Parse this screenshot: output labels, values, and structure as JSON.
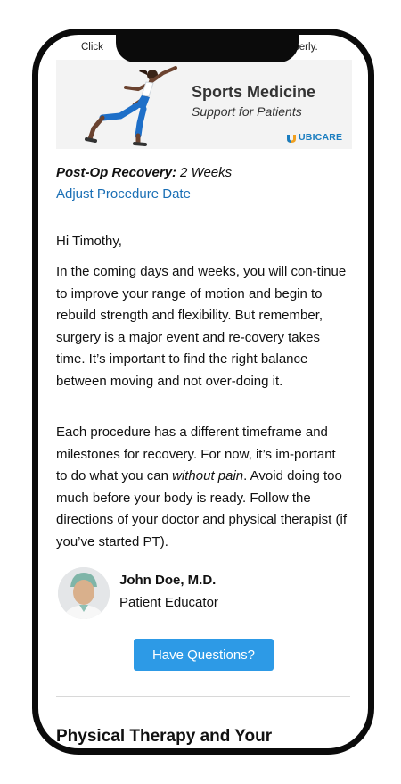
{
  "preheader": {
    "left": "Click",
    "right": "operly."
  },
  "hero": {
    "title": "Sports Medicine",
    "subtitle": "Support for Patients",
    "logo_text": "UBICARE",
    "accent_color": "#1a7dc0"
  },
  "recovery": {
    "label": "Post-Op Recovery:",
    "value": "2 Weeks"
  },
  "adjust_link": "Adjust Procedure Date",
  "greeting": "Hi Timothy,",
  "paragraph_1": "In the coming days and weeks, you will con-tinue to improve your range of motion and begin to rebuild strength and flexibility. But remember, surgery is a major event and re-covery takes time. It’s important to find the right balance between moving and not over-doing it.",
  "paragraph_2": {
    "before": "Each procedure has a different timeframe and milestones for recovery. For now, it’s im-portant to do what you can ",
    "emphasis": "without pain",
    "after": ". Avoid doing too much before your body is ready. Follow the directions of your doctor and physical therapist (if you’ve started PT)."
  },
  "author": {
    "name": "John Doe, M.D.",
    "role": "Patient Educator"
  },
  "cta_button": {
    "label": "Have Questions?",
    "color": "#2d9ae6"
  },
  "section_heading": "Physical Therapy and Your"
}
